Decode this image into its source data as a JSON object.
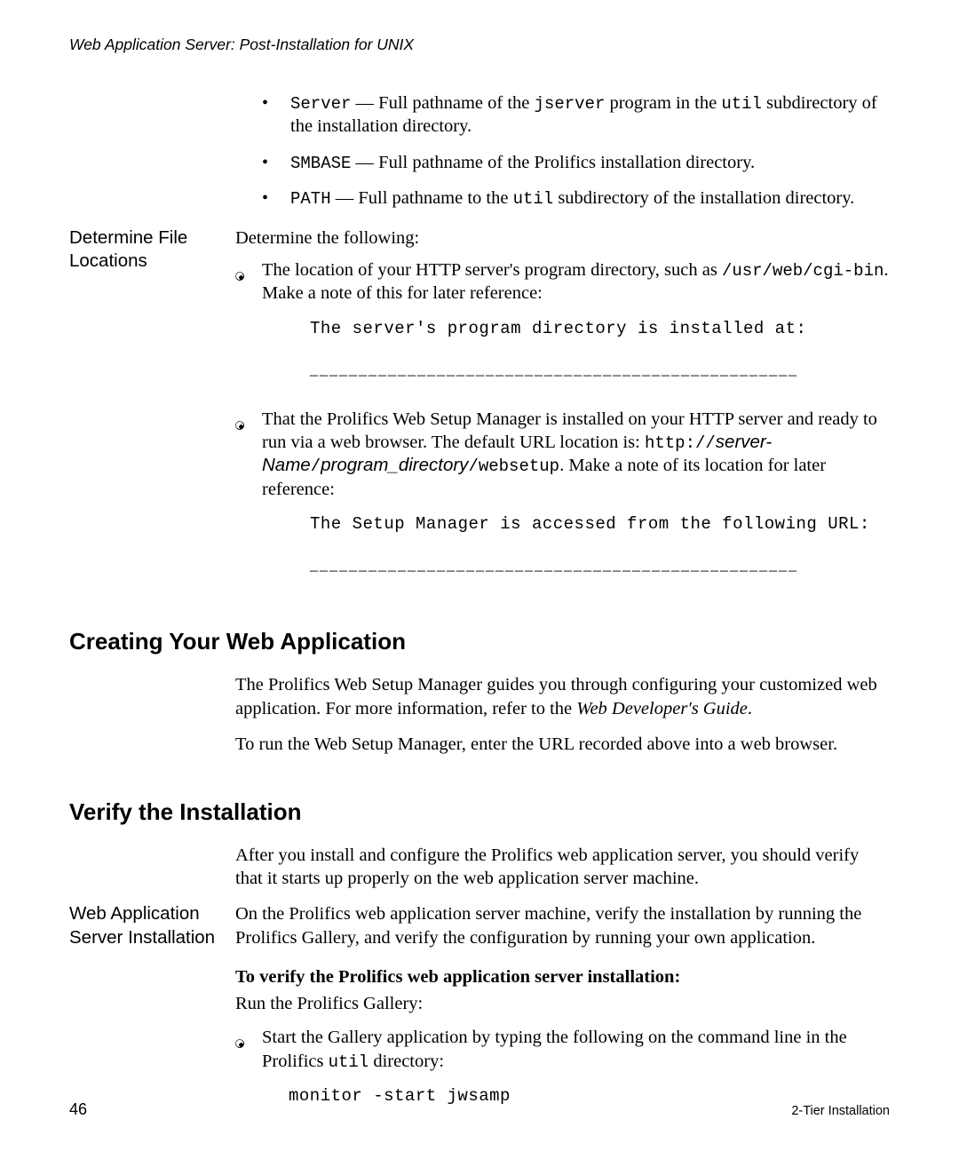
{
  "running_head": "Web Application Server: Post-Installation for UNIX",
  "top_bullets": {
    "b1_code1": "Server",
    "b1_mid": " — Full pathname of the ",
    "b1_code2": "jserver",
    "b1_mid2": " program in the ",
    "b1_code3": "util",
    "b1_tail": " subdirectory of the installation directory.",
    "b2_code": "SMBASE",
    "b2_tail": " — Full pathname of the Prolifics installation directory.",
    "b3_code": "PATH",
    "b3_mid": " — Full pathname to the ",
    "b3_code2": "util",
    "b3_tail": " subdirectory of the installation directory."
  },
  "sec_determine": {
    "side": "Determine File Locations",
    "intro": "Determine the following:",
    "c1_a": "The location of your HTTP server's program directory, such as ",
    "c1_code": "/usr/web/cgi-bin",
    "c1_b": ". Make a note of this for later reference:",
    "c1_mono": "The server's program directory is installed at:",
    "fill": "__________________________________________________",
    "c2_a": "That the Prolifics Web Setup Manager is installed on your HTTP server and ready to run via a web browser. The default URL location is: ",
    "c2_code1": "http://",
    "c2_it1": "server-Name",
    "c2_slash1": "/",
    "c2_it2": "program_directory",
    "c2_slash2": "/",
    "c2_code2": "websetup",
    "c2_b": ". Make a note of its location for later reference:",
    "c2_mono": "The Setup Manager is accessed from the following URL:"
  },
  "sec_create": {
    "h": "Creating Your Web Application",
    "p1a": "The Prolifics Web Setup Manager guides you through configuring your customized web application. For more information, refer to the ",
    "p1_it": "Web Developer's Guide",
    "p1b": ".",
    "p2": "To run the Web Setup Manager, enter the URL recorded above into a web browser."
  },
  "sec_verify": {
    "h": "Verify the Installation",
    "p1": "After you install and configure the Prolifics web application server, you should verify that it starts up properly on the web application server machine.",
    "side": "Web Application Server Installation",
    "p2": "On the Prolifics web application server machine, verify the installation by running the Prolifics Gallery, and verify the configuration by running your own application.",
    "sub": "To verify the Prolifics web application server installation:",
    "p3": "Run the Prolifics Gallery:",
    "c1_a": "Start the Gallery application by typing the following on the command line in the Prolifics ",
    "c1_code": "util",
    "c1_b": " directory:",
    "cmd": "monitor -start jwsamp"
  },
  "footer": {
    "page": "46",
    "title": "2-Tier Installation"
  }
}
